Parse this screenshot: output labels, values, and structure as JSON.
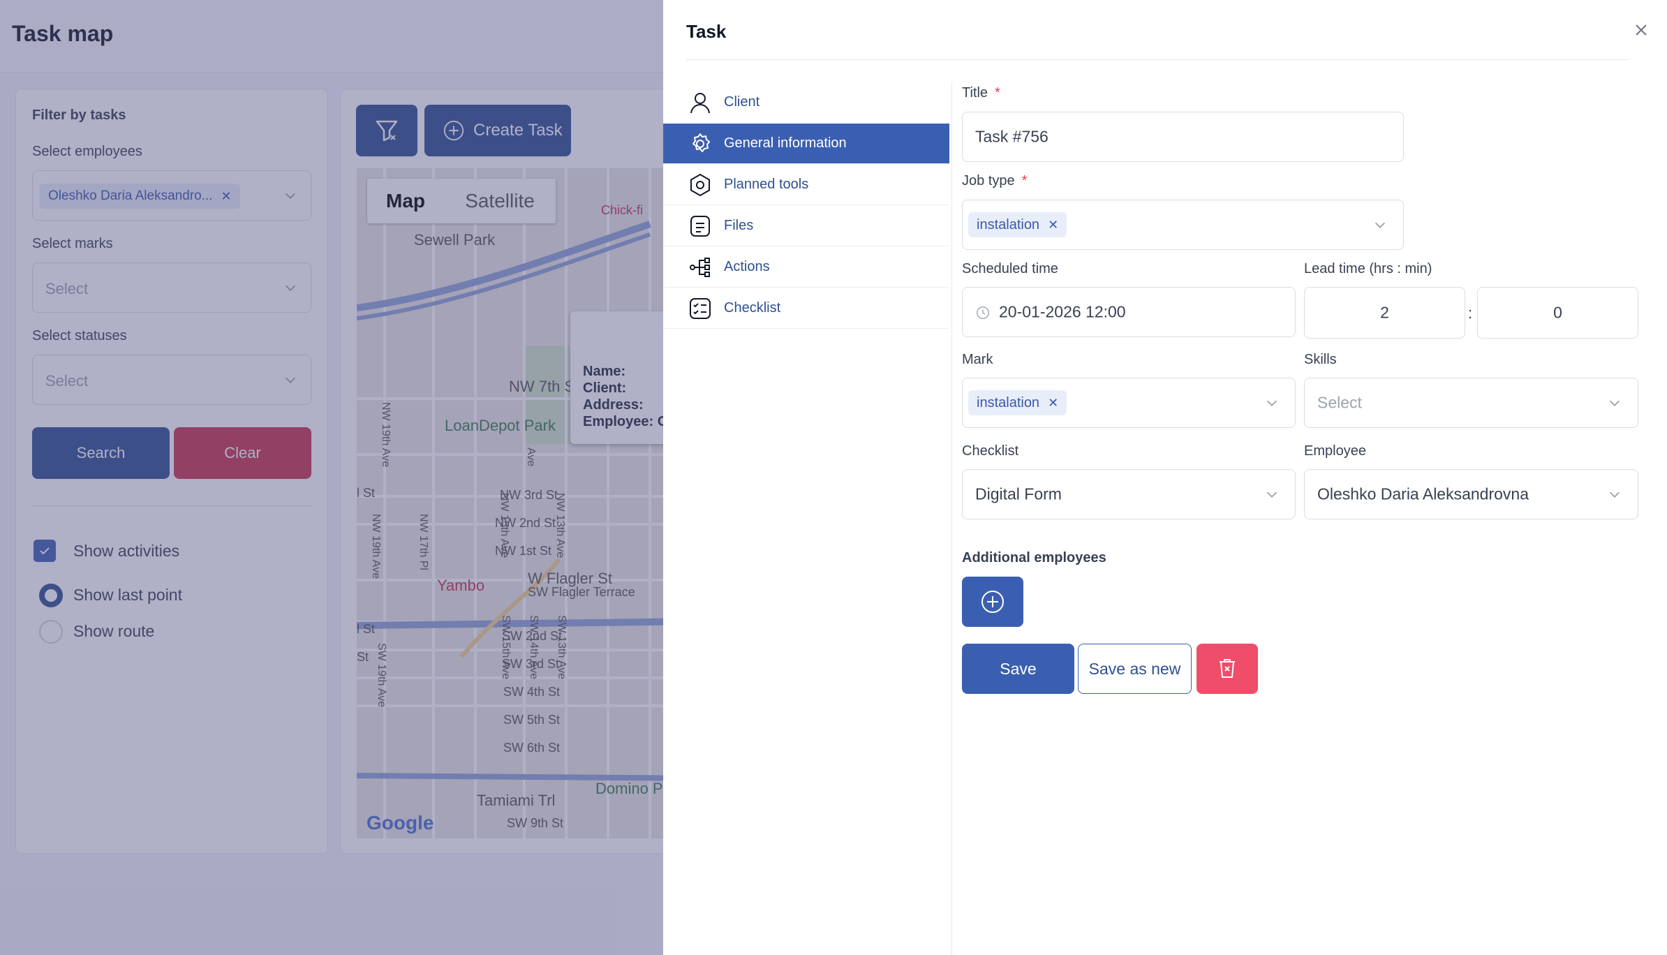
{
  "page": {
    "title": "Task map"
  },
  "filters": {
    "heading": "Filter by tasks",
    "employees_label": "Select employees",
    "employees_chip": "Oleshko Daria Aleksandro...",
    "marks_label": "Select marks",
    "marks_placeholder": "Select",
    "statuses_label": "Select statuses",
    "statuses_placeholder": "Select",
    "search_label": "Search",
    "clear_label": "Clear",
    "show_activities": "Show activities",
    "show_last_point": "Show last point",
    "show_route": "Show route"
  },
  "toolbar": {
    "create_task_label": "Create Task"
  },
  "map": {
    "map_label": "Map",
    "satellite_label": "Satellite",
    "popup_lines": [
      "Name:",
      "Client:",
      "Address:",
      "Employee: O"
    ],
    "labels": {
      "chick": "Chick-fi",
      "sewell": "Sewell Park",
      "nw7": "NW 7th S",
      "loandepot": "LoanDepot Park",
      "nw3": "NW 3rd St",
      "nw2": "NW 2nd St",
      "nw1": "NW 1st St",
      "flagler": "W Flagler St",
      "flagler_terrace": "SW Flagler Terrace",
      "yambo": "Yambo",
      "sw2": "SW 2nd St",
      "sw3": "SW 3rd St",
      "sw4": "SW 4th St",
      "sw5": "SW 5th St",
      "sw6": "SW 6th St",
      "tamiami": "Tamiami Trl",
      "sw9": "SW 9th St",
      "domino": "Domino P",
      "nw19": "NW 19th Ave",
      "nw17": "NW 17th Pl",
      "nw15": "NW 15th Ave",
      "nw13": "NW 13th Ave",
      "sw19": "SW 19th Ave",
      "sw15": "SW 15th Ave",
      "sw14": "SW 14th Ave",
      "sw13": "SW 13th Ave",
      "st1": "l St",
      "st2": "l St",
      "st3": "St",
      "ave": "Ave"
    },
    "google": "Google"
  },
  "drawer": {
    "title": "Task",
    "nav": [
      {
        "label": "Client",
        "icon": "user-icon"
      },
      {
        "label": "General information",
        "icon": "gear-icon"
      },
      {
        "label": "Planned tools",
        "icon": "tool-icon"
      },
      {
        "label": "Files",
        "icon": "file-icon"
      },
      {
        "label": "Actions",
        "icon": "actions-icon"
      },
      {
        "label": "Checklist",
        "icon": "checklist-icon"
      }
    ],
    "form": {
      "title_label": "Title",
      "title_value": "Task #756",
      "job_type_label": "Job type",
      "job_type_chip": "instalation",
      "scheduled_time_label": "Scheduled time",
      "scheduled_time_value": "20-01-2026 12:00",
      "lead_time_label": "Lead time (hrs : min)",
      "lead_hours": "2",
      "lead_separator": ":",
      "lead_minutes": "0",
      "mark_label": "Mark",
      "mark_chip": "instalation",
      "skills_label": "Skills",
      "skills_placeholder": "Select",
      "checklist_label": "Checklist",
      "checklist_value": "Digital Form",
      "employee_label": "Employee",
      "employee_value": "Oleshko Daria Aleksandrovna",
      "required_mark": "*"
    },
    "additional_employees_label": "Additional employees",
    "save_label": "Save",
    "save_as_new_label": "Save as new"
  },
  "colors": {
    "primary": "#3b5fb0",
    "danger": "#f04d6a",
    "clear": "#c9344a"
  }
}
